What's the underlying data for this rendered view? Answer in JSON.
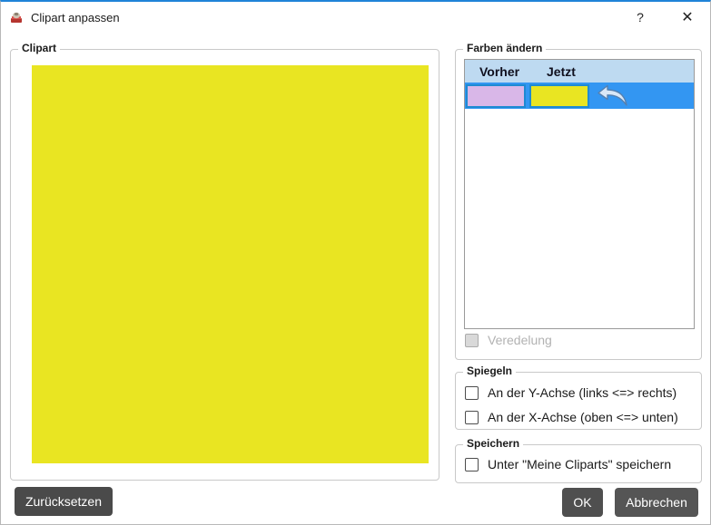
{
  "window": {
    "title": "Clipart anpassen",
    "help_label": "?",
    "close_label": "✕",
    "accent_color": "#1f83d8"
  },
  "clipart_group": {
    "label": "Clipart",
    "fill_color": "#e9e522"
  },
  "colors_group": {
    "label": "Farben ändern",
    "table": {
      "columns": {
        "before": "Vorher",
        "after": "Jetzt"
      },
      "header_bg": "#bedaf1",
      "selected_row_bg": "#3396f2",
      "rows": [
        {
          "before_color": "#d9b7e8",
          "after_color": "#e9e522",
          "selected": true,
          "undo_icon": "undo-arrow"
        }
      ]
    },
    "veredelung": {
      "label": "Veredelung",
      "checked": false,
      "disabled": true
    }
  },
  "mirror_group": {
    "label": "Spiegeln",
    "options": [
      {
        "label": "An der Y-Achse (links <=> rechts)",
        "checked": false
      },
      {
        "label": "An der X-Achse (oben <=> unten)",
        "checked": false
      }
    ]
  },
  "save_group": {
    "label": "Speichern",
    "option": {
      "label": "Unter \"Meine Cliparts\" speichern",
      "checked": false
    }
  },
  "buttons": {
    "reset": "Zurücksetzen",
    "ok": "OK",
    "cancel": "Abbrechen"
  }
}
